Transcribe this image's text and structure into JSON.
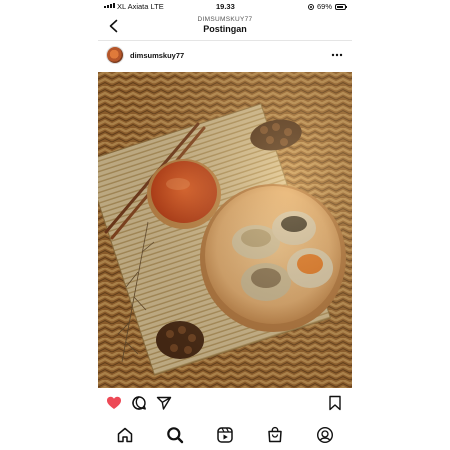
{
  "status_bar": {
    "carrier": "XL Axiata  LTE",
    "time": "19.33",
    "battery": "69%"
  },
  "header": {
    "username": "DIMSUMSKUY77",
    "title": "Postingan",
    "back_icon": "chevron-left-icon"
  },
  "post": {
    "username": "dimsumskuy77",
    "avatar_icon": "avatar",
    "more_icon": "more-horizontal-icon",
    "image": "photo of dim sum on a wooden plate with chili sauce, chopsticks and pine cones on a bamboo mat"
  },
  "actions": {
    "liked": true,
    "like_color": "#ed4956",
    "icons": [
      "heart-icon",
      "comment-icon",
      "share-icon",
      "bookmark-icon"
    ]
  },
  "bottom_nav": {
    "tabs": [
      "home-icon",
      "search-icon",
      "reels-icon",
      "shop-icon",
      "profile-icon"
    ],
    "active": "search-icon"
  }
}
